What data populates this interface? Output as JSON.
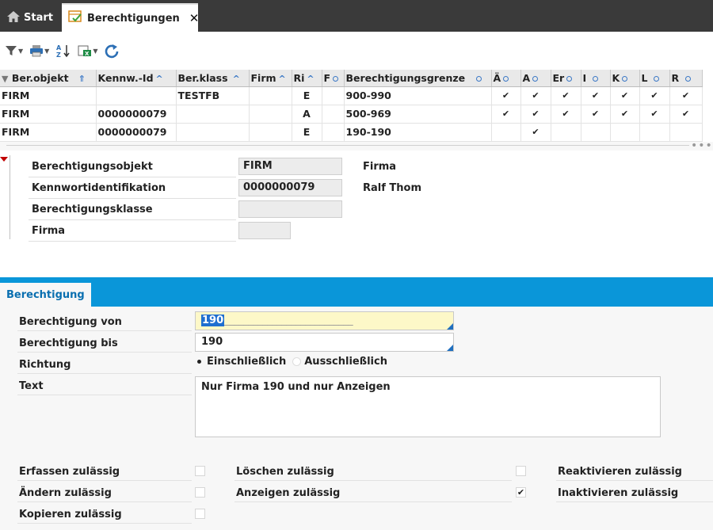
{
  "tabs": {
    "start_label": "Start",
    "active_label": "Berechtigungen",
    "close_glyph": "✕"
  },
  "toolbar": {
    "icons": [
      "filter-icon",
      "print-icon",
      "sort-az-icon",
      "excel-export-icon",
      "refresh-icon"
    ]
  },
  "grid": {
    "columns": [
      {
        "label": "Ber.objekt",
        "indicator": "sort"
      },
      {
        "label": "Kennw.-Id",
        "indicator": "sort"
      },
      {
        "label": "Ber.klass",
        "indicator": "sort"
      },
      {
        "label": "Firm",
        "indicator": "sort"
      },
      {
        "label": "Ri",
        "indicator": "sort"
      },
      {
        "label": "F",
        "indicator": "circle"
      },
      {
        "label": "Berechtigungsgrenze",
        "indicator": "circle"
      },
      {
        "label": "Ä",
        "indicator": "circle"
      },
      {
        "label": "A",
        "indicator": "circle"
      },
      {
        "label": "Er",
        "indicator": "circle"
      },
      {
        "label": "I",
        "indicator": "circle"
      },
      {
        "label": "K",
        "indicator": "circle"
      },
      {
        "label": "L",
        "indicator": "circle"
      },
      {
        "label": "R",
        "indicator": "circle"
      }
    ],
    "rows": [
      [
        "FIRM",
        "",
        "TESTFB",
        "",
        "E",
        "",
        "900-990",
        "✔",
        "✔",
        "✔",
        "✔",
        "✔",
        "✔",
        "✔"
      ],
      [
        "FIRM",
        "0000000079",
        "",
        "",
        "A",
        "",
        "500-969",
        "✔",
        "✔",
        "✔",
        "✔",
        "✔",
        "✔",
        "✔"
      ],
      [
        "FIRM",
        "0000000079",
        "",
        "",
        "E",
        "",
        "190-190",
        "",
        "✔",
        "",
        "",
        "",
        "",
        ""
      ]
    ],
    "more_glyph": "•••"
  },
  "detail": {
    "objekt_label": "Berechtigungsobjekt",
    "objekt_value": "FIRM",
    "objekt_side": "Firma",
    "kennwort_label": "Kennwortidentifikation",
    "kennwort_value": "0000000079",
    "kennwort_side": "Ralf Thom",
    "klasse_label": "Berechtigungsklasse",
    "klasse_value": "",
    "firma_label": "Firma",
    "firma_value": ""
  },
  "form": {
    "tab_label": "Berechtigung",
    "von_label": "Berechtigung von",
    "von_value": "190",
    "von_fill": "___________________________",
    "bis_label": "Berechtigung bis",
    "bis_value": "190",
    "richtung_label": "Richtung",
    "richtung_option_in": "Einschließlich",
    "richtung_option_out": "Ausschließlich",
    "richtung_selected": "Einschließlich",
    "text_label": "Text",
    "text_value": "Nur Firma 190 und nur Anzeigen",
    "perm": {
      "erfassen_label": "Erfassen zulässig",
      "erfassen": false,
      "aendern_label": "Ändern zulässig",
      "aendern": false,
      "kopieren_label": "Kopieren zulässig",
      "kopieren": false,
      "loeschen_label": "Löschen zulässig",
      "loeschen": false,
      "anzeigen_label": "Anzeigen zulässig",
      "anzeigen": true,
      "reaktivieren_label": "Reaktivieren zulässig",
      "inaktivieren_label": "Inaktivieren zulässig"
    }
  },
  "colors": {
    "accent_blue": "#0a96d9",
    "topbar": "#3a3a3a",
    "input_highlight": "#fdf8c8"
  }
}
